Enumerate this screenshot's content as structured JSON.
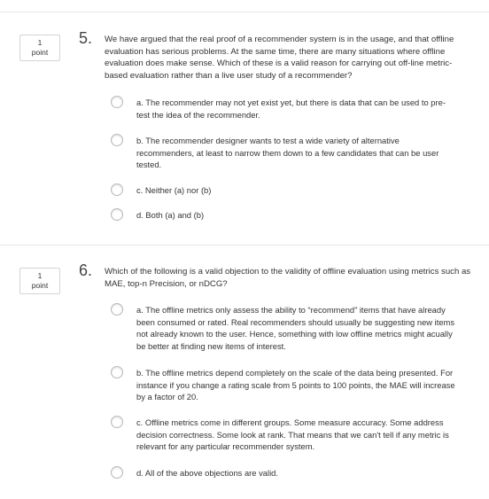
{
  "questions": [
    {
      "number": "5.",
      "points_value": "1",
      "points_label": "point",
      "text": "We have argued that the real proof of a recommender system is in the usage, and that offline evaluation has serious problems. At the same time, there are many situations where offline evaluation does make sense. Which of these is a valid reason for carrying out off-line metric-based evaluation rather than a live user study of a recommender?",
      "options": [
        "a. The recommender may not yet exist yet, but there is data that can be used to pre-test the idea of the recommender.",
        "b. The recommender designer wants to test a wide variety of alternative recommenders, at least to narrow them down to a few candidates that can be user tested.",
        "c. Neither (a) nor (b)",
        "d. Both (a) and (b)"
      ]
    },
    {
      "number": "6.",
      "points_value": "1",
      "points_label": "point",
      "text": "Which of the following is a valid objection to the validity of offline evaluation using metrics such as MAE, top-n Precision, or nDCG?",
      "options": [
        "a. The offline metrics only assess the ability to “recommend” items that have already been consumed or rated. Real recommenders should usually be suggesting new items not already known to the user. Hence, something with low offline metrics might acually be better at finding new items of interest.",
        "b. The offline metrics depend completely on the scale of the data being presented. For instance if you change a rating scale from 5 points to 100 points, the MAE will increase by a factor of 20.",
        "c. Offline metrics come in different groups. Some measure accuracy. Some address decision correctness. Some look at rank. That means that we can't tell if any metric is relevant for any particular recommender system.",
        "d. All of the above objections are valid."
      ]
    }
  ]
}
